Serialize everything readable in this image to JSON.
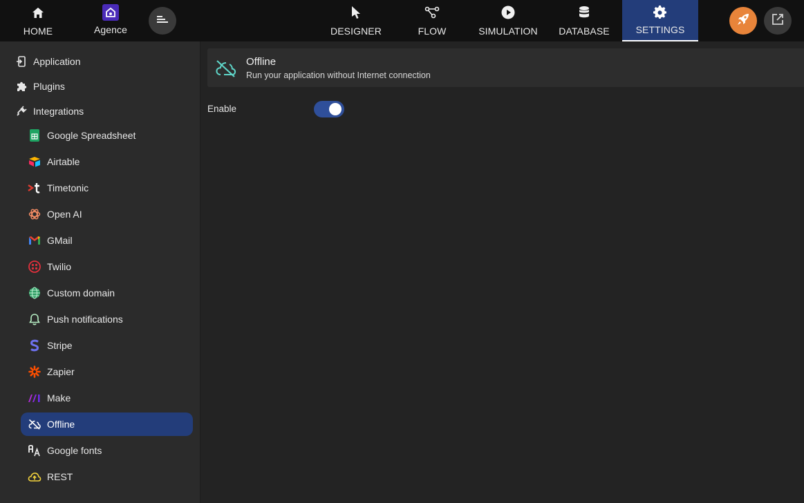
{
  "topbar": {
    "home": {
      "label": "HOME",
      "icon": "home-icon"
    },
    "agence": {
      "label": "Agence",
      "icon": "agence-logo-icon"
    },
    "menu": {
      "icon": "menu-icon"
    },
    "tabs": [
      {
        "label": "DESIGNER",
        "icon": "cursor-icon"
      },
      {
        "label": "FLOW",
        "icon": "flow-icon"
      },
      {
        "label": "SIMULATION",
        "icon": "play-icon"
      },
      {
        "label": "DATABASE",
        "icon": "database-icon"
      },
      {
        "label": "SETTINGS",
        "icon": "gear-icon",
        "active": true
      }
    ],
    "publish": {
      "icon": "rocket-icon",
      "color": "#e8843a"
    },
    "open_external": {
      "icon": "external-link-icon"
    }
  },
  "sidebar": {
    "top_items": [
      {
        "label": "Application",
        "icon": "application-icon"
      },
      {
        "label": "Plugins",
        "icon": "puzzle-icon"
      },
      {
        "label": "Integrations",
        "icon": "plug-icon"
      }
    ],
    "sub_items": [
      {
        "label": "Google Spreadsheet",
        "icon": "google-sheets-icon"
      },
      {
        "label": "Airtable",
        "icon": "airtable-icon"
      },
      {
        "label": "Timetonic",
        "icon": "timetonic-icon"
      },
      {
        "label": "Open AI",
        "icon": "openai-icon"
      },
      {
        "label": "GMail",
        "icon": "gmail-icon"
      },
      {
        "label": "Twilio",
        "icon": "twilio-icon"
      },
      {
        "label": "Custom domain",
        "icon": "globe-icon"
      },
      {
        "label": "Push notifications",
        "icon": "bell-icon"
      },
      {
        "label": "Stripe",
        "icon": "stripe-icon"
      },
      {
        "label": "Zapier",
        "icon": "zapier-icon"
      },
      {
        "label": "Make",
        "icon": "make-icon"
      },
      {
        "label": "Offline",
        "icon": "cloud-off-icon",
        "active": true
      },
      {
        "label": "Google fonts",
        "icon": "font-icon"
      },
      {
        "label": "REST",
        "icon": "cloud-upload-icon"
      }
    ]
  },
  "main": {
    "header": {
      "title": "Offline",
      "subtitle": "Run your application without Internet connection",
      "icon": "cloud-off-icon",
      "icon_color": "#5fd6c9"
    },
    "enable": {
      "label": "Enable",
      "value": true
    }
  },
  "colors": {
    "accent": "#233d7a",
    "toggle": "#2f4f9a",
    "topbar_bg": "#111111",
    "sidebar_bg": "#2b2b2b",
    "main_bg": "#232323"
  }
}
